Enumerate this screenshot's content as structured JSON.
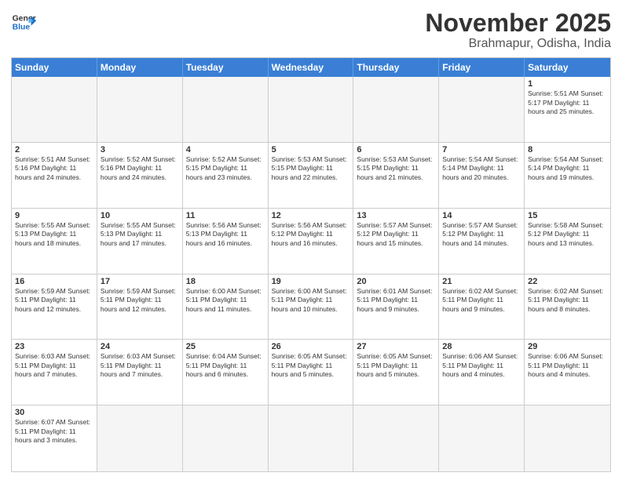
{
  "header": {
    "logo_general": "General",
    "logo_blue": "Blue",
    "month_title": "November 2025",
    "location": "Brahmapur, Odisha, India"
  },
  "day_headers": [
    "Sunday",
    "Monday",
    "Tuesday",
    "Wednesday",
    "Thursday",
    "Friday",
    "Saturday"
  ],
  "cells": [
    {
      "date": "",
      "info": "",
      "empty": true
    },
    {
      "date": "",
      "info": "",
      "empty": true
    },
    {
      "date": "",
      "info": "",
      "empty": true
    },
    {
      "date": "",
      "info": "",
      "empty": true
    },
    {
      "date": "",
      "info": "",
      "empty": true
    },
    {
      "date": "",
      "info": "",
      "empty": true
    },
    {
      "date": "1",
      "info": "Sunrise: 5:51 AM\nSunset: 5:17 PM\nDaylight: 11 hours\nand 25 minutes."
    },
    {
      "date": "2",
      "info": "Sunrise: 5:51 AM\nSunset: 5:16 PM\nDaylight: 11 hours\nand 24 minutes."
    },
    {
      "date": "3",
      "info": "Sunrise: 5:52 AM\nSunset: 5:16 PM\nDaylight: 11 hours\nand 24 minutes."
    },
    {
      "date": "4",
      "info": "Sunrise: 5:52 AM\nSunset: 5:15 PM\nDaylight: 11 hours\nand 23 minutes."
    },
    {
      "date": "5",
      "info": "Sunrise: 5:53 AM\nSunset: 5:15 PM\nDaylight: 11 hours\nand 22 minutes."
    },
    {
      "date": "6",
      "info": "Sunrise: 5:53 AM\nSunset: 5:15 PM\nDaylight: 11 hours\nand 21 minutes."
    },
    {
      "date": "7",
      "info": "Sunrise: 5:54 AM\nSunset: 5:14 PM\nDaylight: 11 hours\nand 20 minutes."
    },
    {
      "date": "8",
      "info": "Sunrise: 5:54 AM\nSunset: 5:14 PM\nDaylight: 11 hours\nand 19 minutes."
    },
    {
      "date": "9",
      "info": "Sunrise: 5:55 AM\nSunset: 5:13 PM\nDaylight: 11 hours\nand 18 minutes."
    },
    {
      "date": "10",
      "info": "Sunrise: 5:55 AM\nSunset: 5:13 PM\nDaylight: 11 hours\nand 17 minutes."
    },
    {
      "date": "11",
      "info": "Sunrise: 5:56 AM\nSunset: 5:13 PM\nDaylight: 11 hours\nand 16 minutes."
    },
    {
      "date": "12",
      "info": "Sunrise: 5:56 AM\nSunset: 5:12 PM\nDaylight: 11 hours\nand 16 minutes."
    },
    {
      "date": "13",
      "info": "Sunrise: 5:57 AM\nSunset: 5:12 PM\nDaylight: 11 hours\nand 15 minutes."
    },
    {
      "date": "14",
      "info": "Sunrise: 5:57 AM\nSunset: 5:12 PM\nDaylight: 11 hours\nand 14 minutes."
    },
    {
      "date": "15",
      "info": "Sunrise: 5:58 AM\nSunset: 5:12 PM\nDaylight: 11 hours\nand 13 minutes."
    },
    {
      "date": "16",
      "info": "Sunrise: 5:59 AM\nSunset: 5:11 PM\nDaylight: 11 hours\nand 12 minutes."
    },
    {
      "date": "17",
      "info": "Sunrise: 5:59 AM\nSunset: 5:11 PM\nDaylight: 11 hours\nand 12 minutes."
    },
    {
      "date": "18",
      "info": "Sunrise: 6:00 AM\nSunset: 5:11 PM\nDaylight: 11 hours\nand 11 minutes."
    },
    {
      "date": "19",
      "info": "Sunrise: 6:00 AM\nSunset: 5:11 PM\nDaylight: 11 hours\nand 10 minutes."
    },
    {
      "date": "20",
      "info": "Sunrise: 6:01 AM\nSunset: 5:11 PM\nDaylight: 11 hours\nand 9 minutes."
    },
    {
      "date": "21",
      "info": "Sunrise: 6:02 AM\nSunset: 5:11 PM\nDaylight: 11 hours\nand 9 minutes."
    },
    {
      "date": "22",
      "info": "Sunrise: 6:02 AM\nSunset: 5:11 PM\nDaylight: 11 hours\nand 8 minutes."
    },
    {
      "date": "23",
      "info": "Sunrise: 6:03 AM\nSunset: 5:11 PM\nDaylight: 11 hours\nand 7 minutes."
    },
    {
      "date": "24",
      "info": "Sunrise: 6:03 AM\nSunset: 5:11 PM\nDaylight: 11 hours\nand 7 minutes."
    },
    {
      "date": "25",
      "info": "Sunrise: 6:04 AM\nSunset: 5:11 PM\nDaylight: 11 hours\nand 6 minutes."
    },
    {
      "date": "26",
      "info": "Sunrise: 6:05 AM\nSunset: 5:11 PM\nDaylight: 11 hours\nand 5 minutes."
    },
    {
      "date": "27",
      "info": "Sunrise: 6:05 AM\nSunset: 5:11 PM\nDaylight: 11 hours\nand 5 minutes."
    },
    {
      "date": "28",
      "info": "Sunrise: 6:06 AM\nSunset: 5:11 PM\nDaylight: 11 hours\nand 4 minutes."
    },
    {
      "date": "29",
      "info": "Sunrise: 6:06 AM\nSunset: 5:11 PM\nDaylight: 11 hours\nand 4 minutes."
    },
    {
      "date": "30",
      "info": "Sunrise: 6:07 AM\nSunset: 5:11 PM\nDaylight: 11 hours\nand 3 minutes."
    },
    {
      "date": "",
      "info": "",
      "empty": true
    },
    {
      "date": "",
      "info": "",
      "empty": true
    },
    {
      "date": "",
      "info": "",
      "empty": true
    },
    {
      "date": "",
      "info": "",
      "empty": true
    },
    {
      "date": "",
      "info": "",
      "empty": true
    },
    {
      "date": "",
      "info": "",
      "empty": true
    }
  ]
}
